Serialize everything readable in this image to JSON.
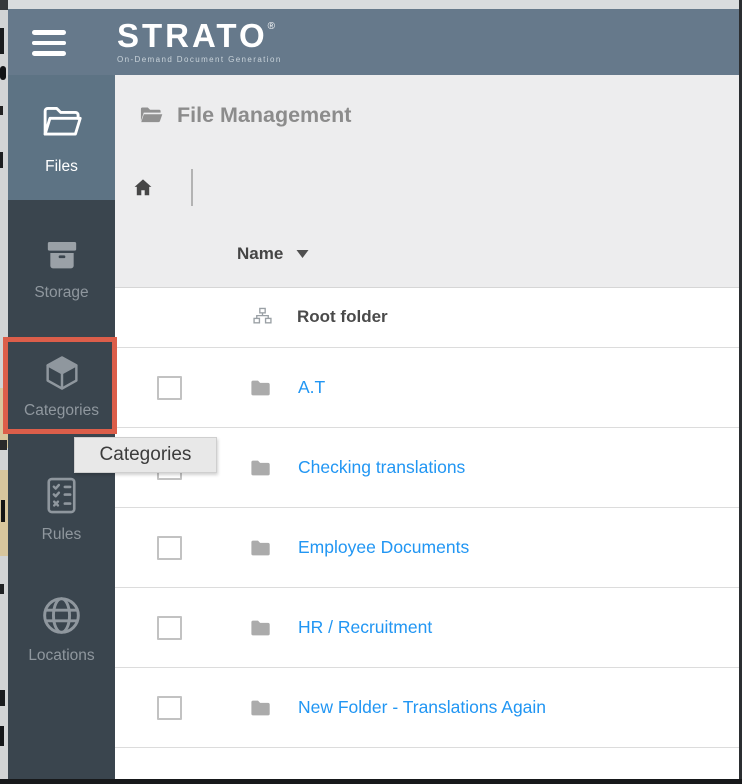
{
  "header": {
    "logo": "STRATO",
    "registered_mark": "®",
    "tagline": "On-Demand Document Generation"
  },
  "sidebar": {
    "items": [
      {
        "label": "Files",
        "icon": "open-folder-icon",
        "active": true
      },
      {
        "label": "Storage",
        "icon": "archive-box-icon",
        "active": false
      },
      {
        "label": "Categories",
        "icon": "cube-icon",
        "active": false,
        "annotated": true
      },
      {
        "label": "Rules",
        "icon": "checklist-icon",
        "active": false
      },
      {
        "label": "Locations",
        "icon": "globe-icon",
        "active": false
      }
    ]
  },
  "annotation": {
    "shape": "rectangle",
    "color": "#dc5e4a",
    "target": "Categories"
  },
  "tooltip": {
    "label": "Categories"
  },
  "main": {
    "page_title": "File Management",
    "title_icon": "open-folder-icon",
    "breadcrumb_icon": "home-icon",
    "table": {
      "name_column": "Name",
      "sort_icon": "triangle-down-icon",
      "root_row_label": "Root folder",
      "root_row_icon": "sitemap-icon",
      "folders": [
        {
          "name": "A.T"
        },
        {
          "name": "Checking translations"
        },
        {
          "name": "Employee Documents"
        },
        {
          "name": "HR / Recruitment"
        },
        {
          "name": "New Folder - Translations Again"
        }
      ]
    }
  },
  "colors": {
    "header_bg": "#66798b",
    "sidebar_bg": "#3a454e",
    "active_item_bg": "#5d7384",
    "sidebar_text": "#8f979e",
    "main_gray_bg": "#ededee",
    "link_blue": "#2196f3",
    "annotation_red": "#dc5e4a",
    "tooltip_bg": "#e8e8e8"
  }
}
